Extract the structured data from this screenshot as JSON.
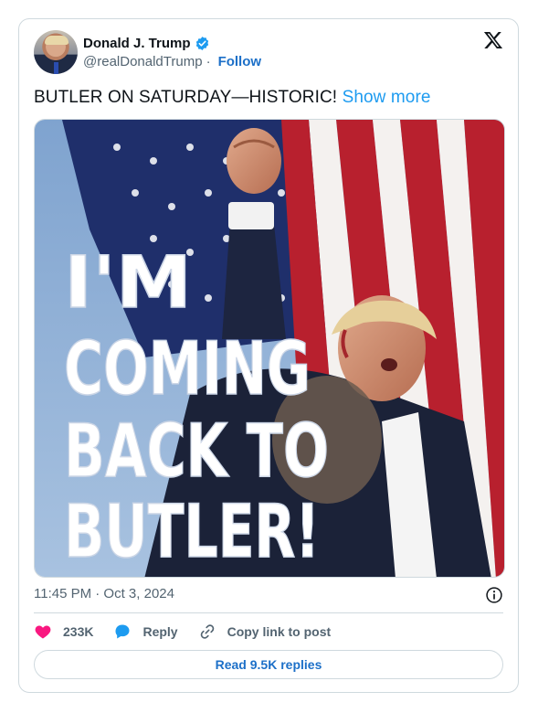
{
  "author": {
    "name": "Donald J. Trump",
    "handle": "@realDonaldTrump",
    "separator": "·",
    "follow_label": "Follow",
    "verified_icon": "verified-badge-icon"
  },
  "platform_icon": "x-logo-icon",
  "tweet": {
    "text": "BUTLER ON SATURDAY—HISTORIC!",
    "show_more_label": "Show more"
  },
  "media": {
    "overlay_lines": [
      "I'M",
      "COMING",
      "BACK TO",
      "BUTLER!"
    ]
  },
  "meta": {
    "timestamp": "11:45 PM · Oct 3, 2024",
    "info_icon": "info-icon"
  },
  "actions": {
    "likes_count": "233K",
    "reply_label": "Reply",
    "copy_link_label": "Copy link to post"
  },
  "read_replies_label": "Read 9.5K replies",
  "colors": {
    "link_blue": "#1d9bf0",
    "follow_blue": "#1d70c8",
    "heart_pink": "#f91880",
    "border": "#cfd9de",
    "muted": "#536471"
  }
}
